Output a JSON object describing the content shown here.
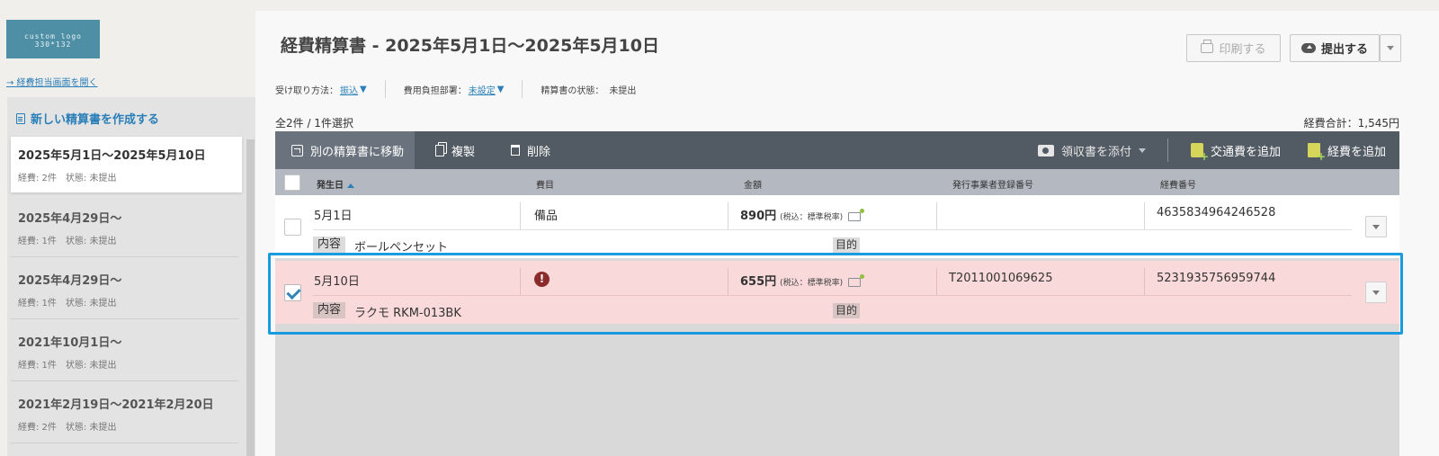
{
  "sidebar": {
    "logo_text_line1": "custom logo",
    "logo_text_line2": "330*132",
    "expense_link": "→ 経費担当画面を開く",
    "new_report_label": "新しい精算書を作成する",
    "reports": [
      {
        "title": "2025年5月1日～2025年5月10日",
        "count": "経費: 2件",
        "status": "状態: 未提出",
        "active": true
      },
      {
        "title": "2025年4月29日～",
        "count": "経費: 1件",
        "status": "状態: 未提出",
        "active": false
      },
      {
        "title": "2025年4月29日～",
        "count": "経費: 1件",
        "status": "状態: 未提出",
        "active": false
      },
      {
        "title": "2021年10月1日～",
        "count": "経費: 1件",
        "status": "状態: 未提出",
        "active": false
      },
      {
        "title": "2021年2月19日～2021年2月20日",
        "count": "経費: 2件",
        "status": "状態: 未提出",
        "active": false
      }
    ]
  },
  "header": {
    "title": "経費精算書 - 2025年5月1日～2025年5月10日",
    "print_label": "印刷する",
    "submit_label": "提出する"
  },
  "info": {
    "receive_method_label": "受け取り方法：",
    "receive_method_value": "振込",
    "department_label": "費用負担部署：",
    "department_value": "未設定",
    "report_status_label": "精算書の状態：",
    "report_status_value": "未提出"
  },
  "summary": {
    "count_text": "全2件 / 1件選択",
    "total_text": "経費合計：1,545円"
  },
  "toolbar": {
    "move_label": "別の精算書に移動",
    "copy_label": "複製",
    "delete_label": "削除",
    "receipt_label": "領収書を添付",
    "transit_label": "交通費を追加",
    "expense_label": "経費を追加"
  },
  "table": {
    "columns": [
      "発生日",
      "費目",
      "金額",
      "発行事業者登録番号",
      "経費番号"
    ],
    "sort_column": "発生日",
    "content_tag": "内容",
    "purpose_tag": "目的",
    "rows": [
      {
        "date": "5月1日",
        "category": "備品",
        "amount": "890円",
        "tax": "(税込：標準税率)",
        "registration_no": "",
        "expense_no": "4635834964246528",
        "content": "ボールペンセット",
        "selected": false,
        "warning": false
      },
      {
        "date": "5月10日",
        "category": "",
        "amount": "655円",
        "tax": "(税込：標準税率)",
        "registration_no": "T2011001069625",
        "expense_no": "5231935756959744",
        "content": "ラクモ RKM-013BK",
        "selected": true,
        "warning": true
      }
    ]
  },
  "colors": {
    "accent": "#2a7fb8",
    "toolbar_bg": "#525a63",
    "selected_row_bg": "#f9d9d9",
    "selection_outline": "#1a9be0",
    "warning": "#8b2b2b"
  }
}
